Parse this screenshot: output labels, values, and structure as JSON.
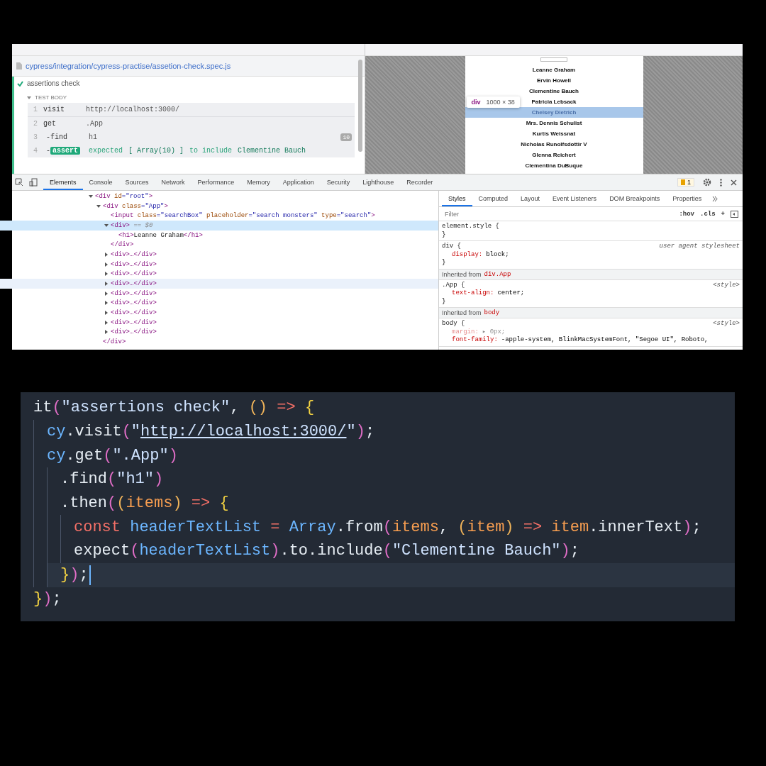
{
  "runner": {
    "spec_path": "cypress/integration/cypress-practise/assetion-check.spec.js",
    "test": {
      "title": "assertions check",
      "passed": true
    },
    "section": {
      "label": "TEST BODY",
      "expanded": true
    },
    "commands": [
      {
        "kind": "parent",
        "number": "1",
        "name": "visit",
        "message": [
          {
            "text": "http://localhost:3000/",
            "kind": "plain"
          }
        ]
      },
      {
        "kind": "parent",
        "number": "2",
        "name": "get",
        "message": [
          {
            "text": ".App",
            "kind": "plain"
          }
        ]
      },
      {
        "kind": "child",
        "number": "3",
        "name": "-find",
        "message": [
          {
            "text": "h1",
            "kind": "plain"
          }
        ],
        "badge": "10"
      },
      {
        "kind": "assertion",
        "number": "4",
        "prefix": "-",
        "name": "assert",
        "message": [
          {
            "text": "expected",
            "kind": "soft"
          },
          {
            "text": "[ Array(10) ]",
            "kind": "strong"
          },
          {
            "text": "to include",
            "kind": "soft"
          },
          {
            "text": "Clementine Bauch",
            "kind": "strong"
          }
        ]
      }
    ]
  },
  "preview": {
    "names": [
      {
        "text": "Leanne Graham",
        "selected": false
      },
      {
        "text": "Ervin Howell",
        "selected": false
      },
      {
        "text": "Clementine Bauch",
        "selected": false
      },
      {
        "text": "Patricia Lebsack",
        "selected": false
      },
      {
        "text": "Chelsey Dietrich",
        "selected": true
      },
      {
        "text": "Mrs. Dennis Schulist",
        "selected": false
      },
      {
        "text": "Kurtis Weissnat",
        "selected": false
      },
      {
        "text": "Nicholas Runolfsdottir V",
        "selected": false
      },
      {
        "text": "Glenna Reichert",
        "selected": false
      },
      {
        "text": "Clementina DuBuque",
        "selected": false
      }
    ],
    "tooltip": {
      "tag": "div",
      "size": "1000 × 38"
    }
  },
  "devtools": {
    "tabs": [
      {
        "label": "Elements",
        "selected": true
      },
      {
        "label": "Console",
        "selected": false
      },
      {
        "label": "Sources",
        "selected": false
      },
      {
        "label": "Network",
        "selected": false
      },
      {
        "label": "Performance",
        "selected": false
      },
      {
        "label": "Memory",
        "selected": false
      },
      {
        "label": "Application",
        "selected": false
      },
      {
        "label": "Security",
        "selected": false
      },
      {
        "label": "Lighthouse",
        "selected": false
      },
      {
        "label": "Recorder",
        "selected": false
      }
    ],
    "issues_count": "1",
    "dom": [
      {
        "tokens": [
          {
            "text": "<div ",
            "kind": "tag"
          },
          {
            "text": "id",
            "kind": "attr"
          },
          {
            "text": "=\"root\"",
            "kind": "value"
          },
          {
            "text": ">",
            "kind": "tag"
          }
        ],
        "expanded": true,
        "selected": false,
        "hovered": false,
        "children": [
          {
            "tokens": [
              {
                "text": "<div ",
                "kind": "tag"
              },
              {
                "text": "class",
                "kind": "attr"
              },
              {
                "text": "=\"App\"",
                "kind": "value"
              },
              {
                "text": ">",
                "kind": "tag"
              }
            ],
            "expanded": true,
            "selected": false,
            "hovered": false,
            "closing": "</div>",
            "children": [
              {
                "tokens": [
                  {
                    "text": "<input ",
                    "kind": "tag"
                  },
                  {
                    "text": "class",
                    "kind": "attr"
                  },
                  {
                    "text": "=\"searchBox\" ",
                    "kind": "value"
                  },
                  {
                    "text": "placeholder",
                    "kind": "attr"
                  },
                  {
                    "text": "=\"search monsters\" ",
                    "kind": "value"
                  },
                  {
                    "text": "type",
                    "kind": "attr"
                  },
                  {
                    "text": "=\"search\"",
                    "kind": "value"
                  },
                  {
                    "text": ">",
                    "kind": "tag"
                  }
                ],
                "selected": false,
                "hovered": false
              },
              {
                "tokens": [
                  {
                    "text": "<div>",
                    "kind": "tag"
                  },
                  {
                    "text": " == $0",
                    "kind": "ref"
                  }
                ],
                "expanded": true,
                "selected": true,
                "hovered": false,
                "closing": "</div>",
                "children": [
                  {
                    "tokens": [
                      {
                        "text": "<h1>",
                        "kind": "tag"
                      },
                      {
                        "text": "Leanne Graham",
                        "kind": "text"
                      },
                      {
                        "text": "</h1>",
                        "kind": "tag"
                      }
                    ],
                    "selected": false,
                    "hovered": false
                  }
                ]
              },
              {
                "tokens": [
                  {
                    "text": "<div>…</div>",
                    "kind": "tag"
                  }
                ],
                "expanded": false,
                "selected": false,
                "hovered": false
              },
              {
                "tokens": [
                  {
                    "text": "<div>…</div>",
                    "kind": "tag"
                  }
                ],
                "expanded": false,
                "selected": false,
                "hovered": false
              },
              {
                "tokens": [
                  {
                    "text": "<div>…</div>",
                    "kind": "tag"
                  }
                ],
                "expanded": false,
                "selected": false,
                "hovered": false
              },
              {
                "tokens": [
                  {
                    "text": "<div>…</div>",
                    "kind": "tag"
                  }
                ],
                "expanded": false,
                "selected": false,
                "hovered": true
              },
              {
                "tokens": [
                  {
                    "text": "<div>…</div>",
                    "kind": "tag"
                  }
                ],
                "expanded": false,
                "selected": false,
                "hovered": false
              },
              {
                "tokens": [
                  {
                    "text": "<div>…</div>",
                    "kind": "tag"
                  }
                ],
                "expanded": false,
                "selected": false,
                "hovered": false
              },
              {
                "tokens": [
                  {
                    "text": "<div>…</div>",
                    "kind": "tag"
                  }
                ],
                "expanded": false,
                "selected": false,
                "hovered": false
              },
              {
                "tokens": [
                  {
                    "text": "<div>…</div>",
                    "kind": "tag"
                  }
                ],
                "expanded": false,
                "selected": false,
                "hovered": false
              },
              {
                "tokens": [
                  {
                    "text": "<div>…</div>",
                    "kind": "tag"
                  }
                ],
                "expanded": false,
                "selected": false,
                "hovered": false
              }
            ]
          }
        ]
      }
    ],
    "style_tabs": [
      {
        "label": "Styles",
        "selected": true
      },
      {
        "label": "Computed",
        "selected": false
      },
      {
        "label": "Layout",
        "selected": false
      },
      {
        "label": "Event Listeners",
        "selected": false
      },
      {
        "label": "DOM Breakpoints",
        "selected": false
      },
      {
        "label": "Properties",
        "selected": false
      }
    ],
    "filter": {
      "placeholder": "Filter"
    },
    "filter_tools": [
      ":hov",
      ".cls",
      "+"
    ],
    "rules": [
      {
        "kind": "rule",
        "selector": "element.style {",
        "close": "}"
      },
      {
        "kind": "rule",
        "selector": "div {",
        "source": "user agent stylesheet",
        "declarations": [
          {
            "prop": "display:",
            "value": "block;",
            "inactive": false
          }
        ],
        "close": "}"
      },
      {
        "kind": "inherited",
        "label": "Inherited from",
        "target": "div.App"
      },
      {
        "kind": "rule",
        "selector": ".App {",
        "source": "<style>",
        "declarations": [
          {
            "prop": "text-align:",
            "value": "center;",
            "inactive": false
          }
        ],
        "close": "}"
      },
      {
        "kind": "inherited",
        "label": "Inherited from",
        "target": "body"
      },
      {
        "kind": "rule",
        "selector": "body {",
        "source": "<style>",
        "declarations": [
          {
            "prop": "margin:",
            "value": "▸ 0px;",
            "inactive": true
          },
          {
            "prop": "font-family:",
            "value": "-apple-system, BlinkMacSystemFont, \"Segoe UI\", Roboto,",
            "inactive": false
          }
        ]
      }
    ]
  },
  "code": [
    {
      "tokens": [
        {
          "text": "it",
          "kind": "fn"
        },
        {
          "text": "(",
          "kind": "paren"
        },
        {
          "text": "\"assertions check\"",
          "kind": "string"
        },
        {
          "text": ", ",
          "kind": "plain"
        },
        {
          "text": "()",
          "kind": "paren2"
        },
        {
          "text": " => ",
          "kind": "op"
        },
        {
          "text": "{",
          "kind": "brace"
        }
      ],
      "current": false,
      "children": [
        {
          "tokens": [
            {
              "text": "cy",
              "kind": "var"
            },
            {
              "text": ".visit",
              "kind": "fn"
            },
            {
              "text": "(",
              "kind": "paren"
            },
            {
              "text": "\"",
              "kind": "string"
            },
            {
              "text": "http://localhost:3000/",
              "kind": "link"
            },
            {
              "text": "\"",
              "kind": "string"
            },
            {
              "text": ")",
              "kind": "paren"
            },
            {
              "text": ";",
              "kind": "plain"
            }
          ],
          "current": false
        },
        {
          "tokens": [
            {
              "text": "cy",
              "kind": "var"
            },
            {
              "text": ".get",
              "kind": "fn"
            },
            {
              "text": "(",
              "kind": "paren"
            },
            {
              "text": "\".App\"",
              "kind": "string"
            },
            {
              "text": ")",
              "kind": "paren"
            }
          ],
          "current": false,
          "children": [
            {
              "tokens": [
                {
                  "text": ".find",
                  "kind": "fn"
                },
                {
                  "text": "(",
                  "kind": "paren"
                },
                {
                  "text": "\"h1\"",
                  "kind": "string"
                },
                {
                  "text": ")",
                  "kind": "paren"
                }
              ],
              "current": false
            },
            {
              "tokens": [
                {
                  "text": ".then",
                  "kind": "fn"
                },
                {
                  "text": "(",
                  "kind": "paren"
                },
                {
                  "text": "(",
                  "kind": "paren2"
                },
                {
                  "text": "items",
                  "kind": "param"
                },
                {
                  "text": ")",
                  "kind": "paren2"
                },
                {
                  "text": " => ",
                  "kind": "op"
                },
                {
                  "text": "{",
                  "kind": "brace"
                }
              ],
              "current": false,
              "children": [
                {
                  "tokens": [
                    {
                      "text": "const ",
                      "kind": "op"
                    },
                    {
                      "text": "headerTextList",
                      "kind": "var"
                    },
                    {
                      "text": " = ",
                      "kind": "op"
                    },
                    {
                      "text": "Array",
                      "kind": "var"
                    },
                    {
                      "text": ".from",
                      "kind": "fn"
                    },
                    {
                      "text": "(",
                      "kind": "paren"
                    },
                    {
                      "text": "items",
                      "kind": "param"
                    },
                    {
                      "text": ", ",
                      "kind": "plain"
                    },
                    {
                      "text": "(",
                      "kind": "paren2"
                    },
                    {
                      "text": "item",
                      "kind": "param"
                    },
                    {
                      "text": ")",
                      "kind": "paren2"
                    },
                    {
                      "text": " => ",
                      "kind": "op"
                    },
                    {
                      "text": "item",
                      "kind": "param"
                    },
                    {
                      "text": ".innerText",
                      "kind": "fn"
                    },
                    {
                      "text": ")",
                      "kind": "paren"
                    },
                    {
                      "text": ";",
                      "kind": "plain"
                    }
                  ],
                  "current": false
                },
                {
                  "tokens": [
                    {
                      "text": "expect",
                      "kind": "fn"
                    },
                    {
                      "text": "(",
                      "kind": "paren"
                    },
                    {
                      "text": "headerTextList",
                      "kind": "var"
                    },
                    {
                      "text": ")",
                      "kind": "paren"
                    },
                    {
                      "text": ".to",
                      "kind": "fn"
                    },
                    {
                      "text": ".include",
                      "kind": "fn"
                    },
                    {
                      "text": "(",
                      "kind": "paren"
                    },
                    {
                      "text": "\"Clementine Bauch\"",
                      "kind": "string"
                    },
                    {
                      "text": ")",
                      "kind": "paren"
                    },
                    {
                      "text": ";",
                      "kind": "plain"
                    }
                  ],
                  "current": false
                }
              ]
            },
            {
              "tokens": [
                {
                  "text": "}",
                  "kind": "brace"
                },
                {
                  "text": ")",
                  "kind": "paren"
                },
                {
                  "text": ";",
                  "kind": "plain"
                }
              ],
              "current": true
            }
          ]
        }
      ]
    },
    {
      "tokens": [
        {
          "text": "}",
          "kind": "brace"
        },
        {
          "text": ")",
          "kind": "paren"
        },
        {
          "text": ";",
          "kind": "plain"
        }
      ],
      "current": false
    }
  ]
}
